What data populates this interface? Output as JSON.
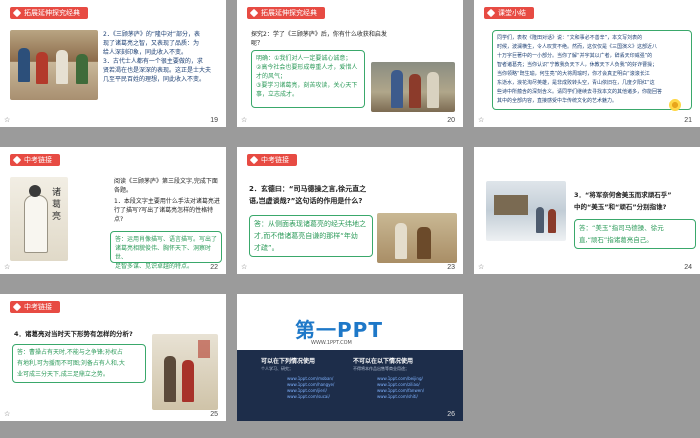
{
  "slides": [
    {
      "num": "19",
      "tag": "拓展延伸探究经典",
      "lines": [
        "2．《三顾茅庐》的“隆中对”部分，表",
        "现了诸葛亮之智，又表现了品质：为",
        "给人深刻印象，同此收入不变。",
        "3．古代士人都有一个很主要做的，求",
        "贤若渴在也是深深的表现。这正是士大夫",
        "几至平民百姓的理想，同此收入不变。"
      ]
    },
    {
      "num": "20",
      "tag": "拓展延伸探究经典",
      "question": "探究2：学了《三顾茅庐》后，你有什么收获和启发呢？",
      "answer": [
        "明确：①我们对人一定要诚心诚意；",
        "②高今社会也要形成尊重人才，爱惜人",
        "才的风气；",
        "③要学习诸葛亮，刻苦攻读，关心天下",
        "事，立志成才。"
      ]
    },
    {
      "num": "21",
      "tag": "课堂小结",
      "lines": [
        "同学们，表权《隆田对话》说：“文和事必不善辛”，本文写刘表的",
        "时候，波澜横生，令人叹赏不绝。然而，这仅仅是《三国演义》这部近八",
        "十万字巨著中的一小部分。当你了解“并宇其以广者，辞丢天印威强”的",
        "智者诸葛亮；当你认识“宁教我负天下人，休教天下人负我”的好诈曹操；",
        "当你领略“既生瑜，何生亮”的大将周瑜时，你才会真正明白“滚滚长江",
        "东逝水，浪花淘尽英雄，是非成败转头空，青山依旧在，几度夕阳红”这",
        "些诗中所蕴含的深刻含义。请同学们继续去寻找本文的其他诸多，你能回答",
        "其中的全部内容，直接感受中华传统文化的艺术魅力。"
      ]
    },
    {
      "num": "22",
      "tag": "中考链接",
      "intro": "阅读《三顾茅庐》第三段文字,完成下面各题。",
      "question": "1．本段文字主要用什么手法对诸葛亮进行了描写?写出了诸葛亮怎样的性格特点?",
      "answer": [
        "答：运用肖像描写、语言描写。写出了",
        "诸葛亮相貌俊伟、胸怀天下、洞察时世、",
        "足智多谋、见识卓越的特点。"
      ]
    },
    {
      "num": "23",
      "tag": "中考链接",
      "question": [
        "2．玄德曰：“司马德操之言,徐元直之",
        "语,岂虚谈哉?”这句话的作用是什么?"
      ],
      "answer": [
        "答：从侧面表现诸葛亮的经天纬地之",
        "才,而不借诸葛亮自谦的那样“年幼",
        "才疏”。"
      ]
    },
    {
      "num": "24",
      "question": [
        "3．“将军奈何舍美玉而求顽石乎”",
        "中的“美玉”和“顽石”分别指谁?"
      ],
      "answer": [
        "答：“美玉”指司马德操、徐元",
        "直,“顽石”指诸葛亮自己。"
      ]
    },
    {
      "num": "25",
      "tag": "中考链接",
      "question": "4．诸葛亮对当时天下形势有怎样的分析?",
      "answer": [
        "答：曹操占有天时,不能与之争锋;孙权占",
        "有地利,可为援而不可图;刘备占有人和,大",
        "业可成三分天下,成三足鼎立之势。"
      ]
    },
    {
      "num": "26",
      "logo": "第一PPT",
      "url": "WWW.1PPT.COM",
      "left_title": "可以在下列情况使用",
      "right_title": "不可以在以下情况使用",
      "left_note": "个人学习、研究；",
      "right_note": "不得将本作品出售等商业用途；",
      "links": [
        "www.1ppt.com/moban/",
        "www.1ppt.com/hangye/",
        "www.1ppt.com/jieri/",
        "www.1ppt.com/sucai/",
        "www.1ppt.com/beijing/",
        "www.1ppt.com/ziliao/",
        "www.1ppt.com/fanwen/",
        "www.1ppt.com/shiti/"
      ]
    }
  ]
}
